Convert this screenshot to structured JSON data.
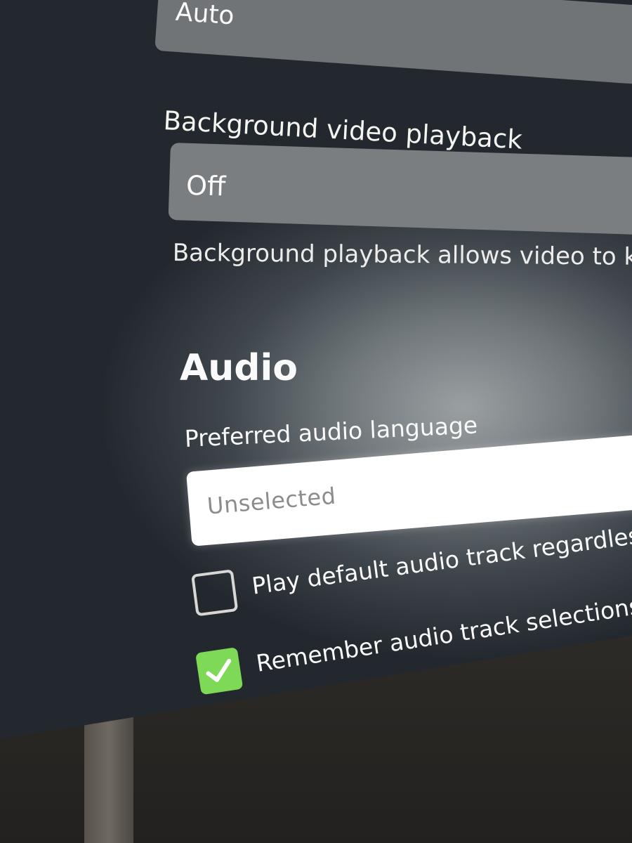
{
  "video": {
    "quality_value": "Auto",
    "background_playback": {
      "label": "Background video playback",
      "value": "Off",
      "help": "Background playback allows video to ke"
    }
  },
  "audio": {
    "heading": "Audio",
    "preferred_language": {
      "label": "Preferred audio language",
      "placeholder": "Unselected"
    },
    "options": [
      {
        "label": "Play default audio track regardless of",
        "checked": false
      },
      {
        "label": "Remember audio track selections",
        "checked": true
      }
    ]
  },
  "colors": {
    "checkbox_checked": "#7ed957"
  }
}
